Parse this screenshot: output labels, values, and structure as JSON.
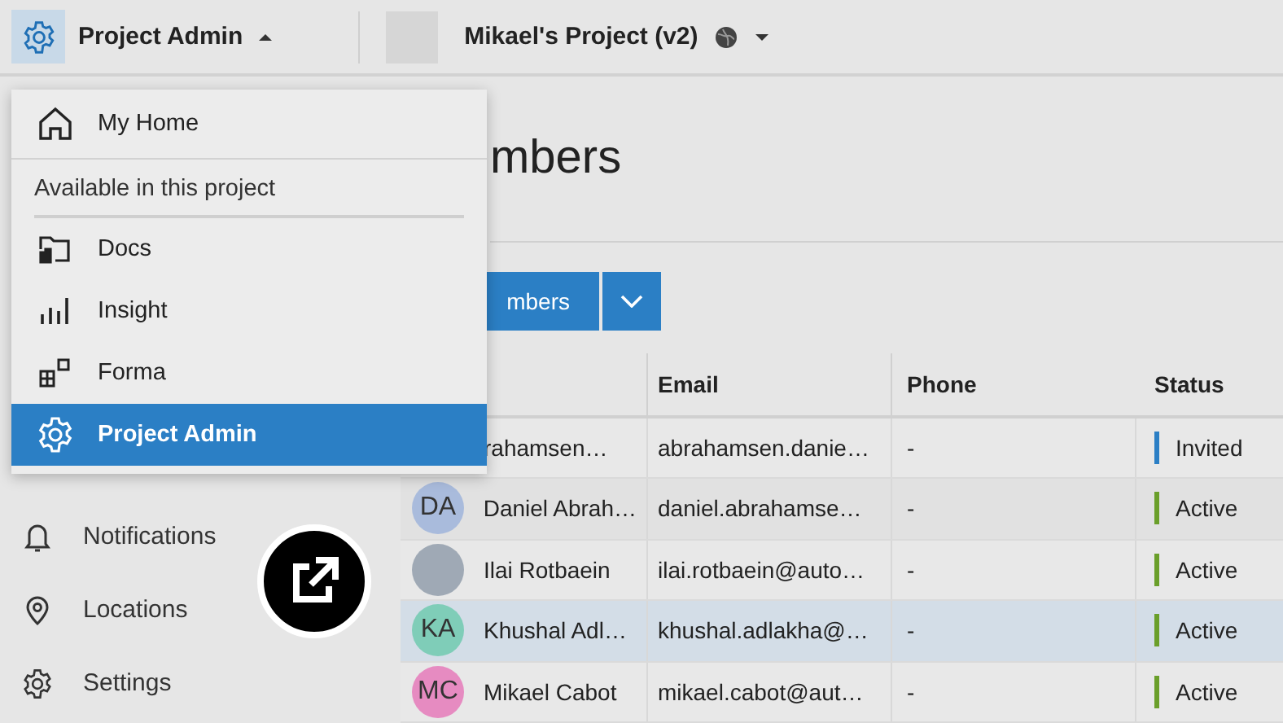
{
  "top_bar": {
    "app_menu": {
      "label": "Project Admin",
      "expanded": true
    },
    "project": {
      "name": "Mikael's Project (v2)"
    }
  },
  "app_menu_dropdown": {
    "home": {
      "label": "My Home"
    },
    "section_title": "Available in this project",
    "items": [
      {
        "label": "Docs",
        "selected": false
      },
      {
        "label": "Insight",
        "selected": false
      },
      {
        "label": "Forma",
        "selected": false
      },
      {
        "label": "Project Admin",
        "selected": true
      }
    ]
  },
  "sidebar": {
    "items": [
      {
        "label": "Notifications"
      },
      {
        "label": "Locations"
      },
      {
        "label": "Settings"
      }
    ]
  },
  "page": {
    "title": "mbers",
    "add_button": "mbers"
  },
  "table": {
    "columns": [
      "Email",
      "Phone",
      "Status"
    ],
    "rows": [
      {
        "name": "rahamsen…",
        "email": "abrahamsen.danie…",
        "phone": "-",
        "status": {
          "label": "Invited",
          "color": "#2b7fc5"
        },
        "highlighted": false
      },
      {
        "avatar": {
          "kind": "initials",
          "initials": "DA",
          "color": "#a9bbdc"
        },
        "name": "Daniel Abrah…",
        "email": "daniel.abrahamse…",
        "phone": "-",
        "status": {
          "label": "Active",
          "color": "#6a9f2a"
        },
        "highlighted": false
      },
      {
        "avatar": {
          "kind": "photo"
        },
        "name": "Ilai Rotbaein",
        "email": "ilai.rotbaein@auto…",
        "phone": "-",
        "status": {
          "label": "Active",
          "color": "#6a9f2a"
        },
        "highlighted": false
      },
      {
        "avatar": {
          "kind": "initials",
          "initials": "KA",
          "color": "#7fcdb8"
        },
        "name": "Khushal Adl…",
        "email": "khushal.adlakha@…",
        "phone": "-",
        "status": {
          "label": "Active",
          "color": "#6a9f2a"
        },
        "highlighted": true
      },
      {
        "avatar": {
          "kind": "initials",
          "initials": "MC",
          "color": "#e68bc1"
        },
        "name": "Mikael Cabot",
        "email": "mikael.cabot@aut…",
        "phone": "-",
        "status": {
          "label": "Active",
          "color": "#6a9f2a"
        },
        "highlighted": false
      }
    ]
  }
}
